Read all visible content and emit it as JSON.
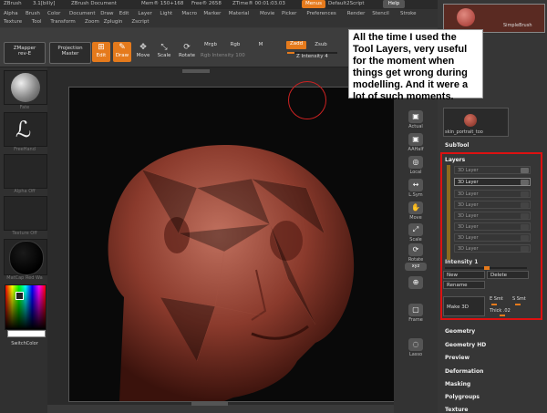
{
  "titlebar": {
    "app": "ZBrush",
    "version": "3.1[billy]",
    "doc": "ZBrush Document",
    "mem": "Mem® 150+168",
    "free": "Free® 2658",
    "ztime": "ZTime® 00:01:03.03",
    "menus_btn": "Menus",
    "default_script": "Default2Script",
    "help_btn": "Help"
  },
  "menus": [
    "Alpha",
    "Brush",
    "Color",
    "Document",
    "Draw",
    "Edit",
    "Layer",
    "Light",
    "Macro",
    "Marker",
    "Material",
    "Movie",
    "Picker",
    "Preferences",
    "Render",
    "Stencil",
    "Stroke",
    "Texture",
    "Tool",
    "Transform",
    "Zoom",
    "Zplugin",
    "Zscript"
  ],
  "toolbar": {
    "zmapper": "ZMapper",
    "zmapper_sub": "rev-E",
    "projection": "Projection",
    "projection_sub": "Master",
    "edit": "Edit",
    "draw": "Draw",
    "move": "Move",
    "scale": "Scale",
    "rotate": "Rotate",
    "mrgb": "Mrgb",
    "rgb": "Rgb",
    "m": "M",
    "rgb_intensity": "Rgb Intensity 100",
    "zadd": "Zadd",
    "zsub": "Zsub",
    "z_intensity": "Z Intensity 4"
  },
  "leftshelf": {
    "labels": [
      "Fate",
      "FreeHand",
      "Alpha Off",
      "Texture Off",
      "MatCap Red Wa"
    ],
    "switch_color": "SwitchColor"
  },
  "rightstrip": {
    "icons": [
      {
        "label": "Actual",
        "sym": "▣"
      },
      {
        "label": "AAHalf",
        "sym": "▣"
      },
      {
        "label": "Local",
        "sym": "◎"
      },
      {
        "label": "L.Sym",
        "sym": "↔"
      },
      {
        "label": "Move",
        "sym": "✋"
      },
      {
        "label": "Scale",
        "sym": "⤢"
      },
      {
        "label": "Rotate",
        "sym": "⟳"
      },
      {
        "label": "Xyz",
        "sym": "xyz"
      },
      {
        "label": "",
        "sym": "⊕"
      },
      {
        "label": "Frame",
        "sym": "▢"
      },
      {
        "label": "Lasso",
        "sym": "◌"
      }
    ]
  },
  "rightpanel": {
    "brush_label": "SimpleBrush",
    "tool_label": "skin_portrait_too",
    "subtool": "SubTool",
    "layers_title": "Layers",
    "layers": [
      "3D Layer",
      "3D Layer",
      "3D Layer",
      "3D Layer",
      "3D Layer",
      "3D Layer",
      "3D Layer",
      "3D Layer"
    ],
    "intensity": "Intensity 1",
    "intensity_value": 0.5,
    "new_btn": "New",
    "delete_btn": "Delete",
    "rename_btn": "Rename",
    "make3d_btn": "Make 3D",
    "esmt": "E Smt",
    "ssmt": "S Smt",
    "thick": "Thick .02",
    "sections": [
      "Geometry",
      "Geometry HD",
      "Preview",
      "Deformation",
      "Masking",
      "Polygroups",
      "Texture"
    ]
  },
  "callout": {
    "text": "All the time I used the Tool Layers, very useful for the moment when things get wrong during modelling. And it were a lot of such moments."
  },
  "colors": {
    "accent": "#e57a1c",
    "highlight_box": "#dd1111",
    "head": "#8a3a2c"
  }
}
